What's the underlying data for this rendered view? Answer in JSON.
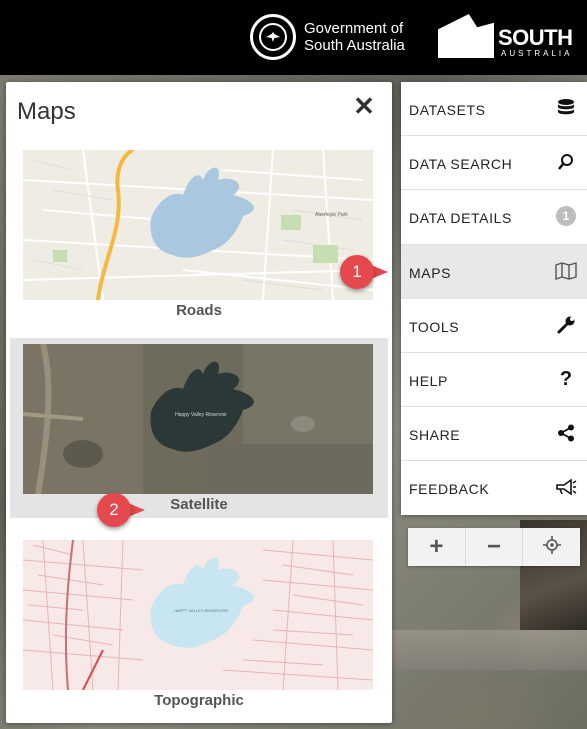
{
  "header": {
    "gov_line1": "Government of",
    "gov_line2": "South Australia",
    "sa_big": "SOUTH",
    "sa_small": "AUSTRALIA",
    "seal_label": "SOUTH AUSTRALIA"
  },
  "maps_panel": {
    "title": "Maps",
    "close_icon": "close-icon",
    "options": [
      {
        "label": "Roads",
        "selected": false
      },
      {
        "label": "Satellite",
        "selected": true
      },
      {
        "label": "Topographic",
        "selected": false
      }
    ],
    "thumb_texts": {
      "satellite_lake": "Happy Valley Reservoir",
      "topo_lake": "HAPPY VALLEY RESERVOIR",
      "roads_place": "Aberfoyle Park"
    }
  },
  "menu": {
    "items": [
      {
        "label": "DATASETS",
        "icon": "database-icon"
      },
      {
        "label": "DATA SEARCH",
        "icon": "search-icon"
      },
      {
        "label": "DATA DETAILS",
        "icon": "badge",
        "badge": "1"
      },
      {
        "label": "MAPS",
        "icon": "map-icon",
        "active": true
      },
      {
        "label": "TOOLS",
        "icon": "wrench-icon"
      },
      {
        "label": "HELP",
        "icon": "question-icon"
      },
      {
        "label": "SHARE",
        "icon": "share-icon"
      },
      {
        "label": "FEEDBACK",
        "icon": "megaphone-icon"
      }
    ]
  },
  "zoom": {
    "zoom_in": "+",
    "zoom_out": "−",
    "locate_icon": "crosshair-icon"
  },
  "callouts": [
    {
      "number": "1"
    },
    {
      "number": "2"
    }
  ],
  "colors": {
    "header_bg": "#000000",
    "callout": "#e5484d",
    "active_menu": "#e8e8e8"
  }
}
